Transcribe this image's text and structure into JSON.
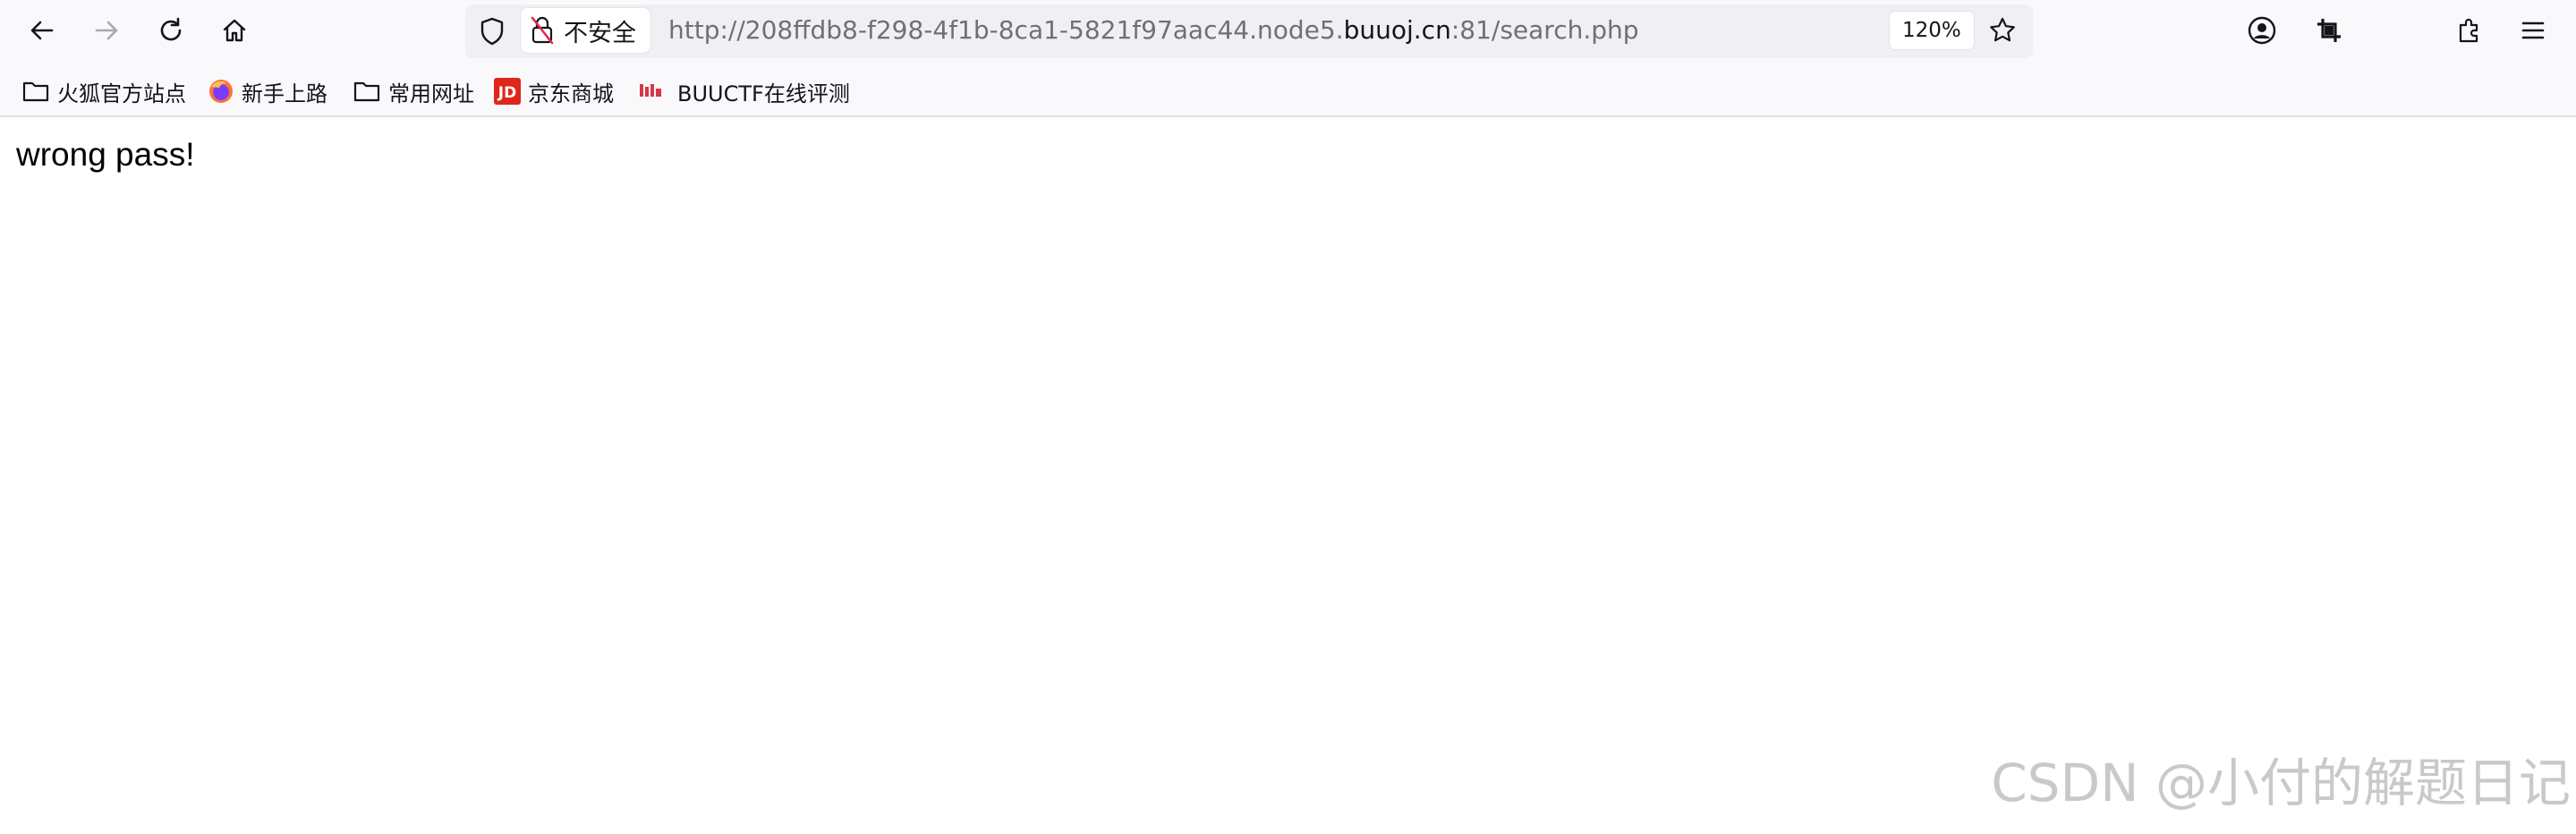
{
  "toolbar": {
    "security_label": "不安全",
    "url_prefix": "http://208ffdb8-f298-4f1b-8ca1-5821f97aac44.node5.",
    "url_domain": "buuoj.cn",
    "url_suffix": ":81/search.php",
    "zoom": "120%",
    "icons": [
      "back-icon",
      "forward-icon",
      "reload-icon",
      "home-icon",
      "shield-icon",
      "insecure-lock-icon",
      "bookmark-star-icon",
      "account-icon",
      "screenshot-crop-icon",
      "extensions-icon",
      "menu-icon"
    ]
  },
  "bookmarks": [
    {
      "label": "火狐官方站点",
      "icon": "folder-icon"
    },
    {
      "label": "新手上路",
      "icon": "firefox-icon"
    },
    {
      "label": "常用网址",
      "icon": "folder-icon"
    },
    {
      "label": "京东商城",
      "icon": "jd-icon"
    },
    {
      "label": "BUUCTF在线评测",
      "icon": "buuctf-icon"
    }
  ],
  "page": {
    "message": "wrong pass!"
  },
  "watermark": "CSDN @小付的解题日记",
  "colors": {
    "toolbar_bg": "#f9f9fb",
    "urlbar_bg": "#f0f0f4",
    "text": "#15141a",
    "url_muted": "#6f6f78",
    "jd_red": "#e1251b",
    "watermark": "#c9c9cc"
  }
}
